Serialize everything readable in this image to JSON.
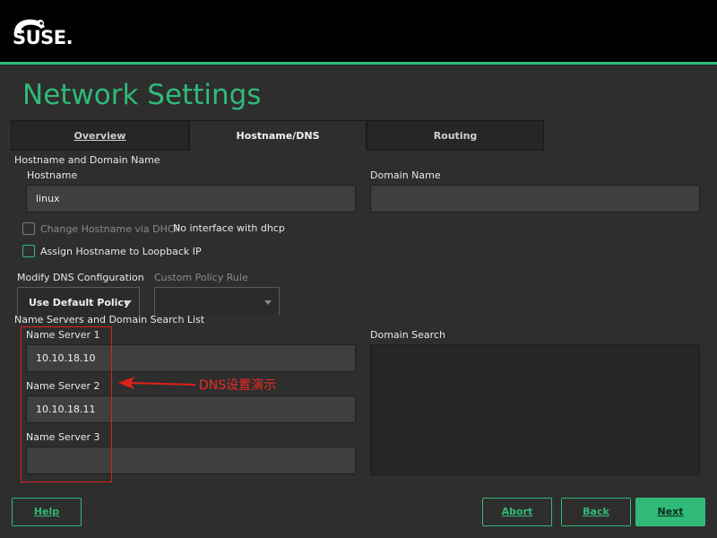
{
  "app": {
    "logo_text": "SUSE.",
    "page_title": "Network Settings"
  },
  "colors": {
    "accent": "#30ba78",
    "annotation": "#e0201a"
  },
  "tabs": [
    {
      "label": "Overview",
      "active": false
    },
    {
      "label": "Hostname/DNS",
      "active": true
    },
    {
      "label": "Routing",
      "active": false
    }
  ],
  "hostname_section": {
    "group_label": "Hostname and Domain Name",
    "hostname_label": "Hostname",
    "hostname_value": "linux",
    "domain_label": "Domain Name",
    "domain_value": "",
    "change_via_dhcp_label": "Change Hostname via DHCP",
    "change_via_dhcp_checked": false,
    "dhcp_status": "No interface with dhcp",
    "loopback_label": "Assign Hostname to Loopback IP",
    "loopback_checked": false
  },
  "dns_config": {
    "modify_label": "Modify DNS Configuration",
    "modify_value": "Use Default Policy",
    "custom_policy_label": "Custom Policy Rule",
    "custom_policy_value": ""
  },
  "name_servers": {
    "group_label": "Name Servers and Domain Search List",
    "ns1_label": "Name Server 1",
    "ns1_value": "10.10.18.10",
    "ns2_label": "Name Server 2",
    "ns2_value": "10.10.18.11",
    "ns3_label": "Name Server 3",
    "ns3_value": "",
    "domain_search_label": "Domain Search",
    "domain_search_value": ""
  },
  "annotation": {
    "text": "DNS设置演示"
  },
  "footer": {
    "help_label": "Help",
    "abort_label": "Abort",
    "back_label": "Back",
    "next_label": "Next"
  }
}
